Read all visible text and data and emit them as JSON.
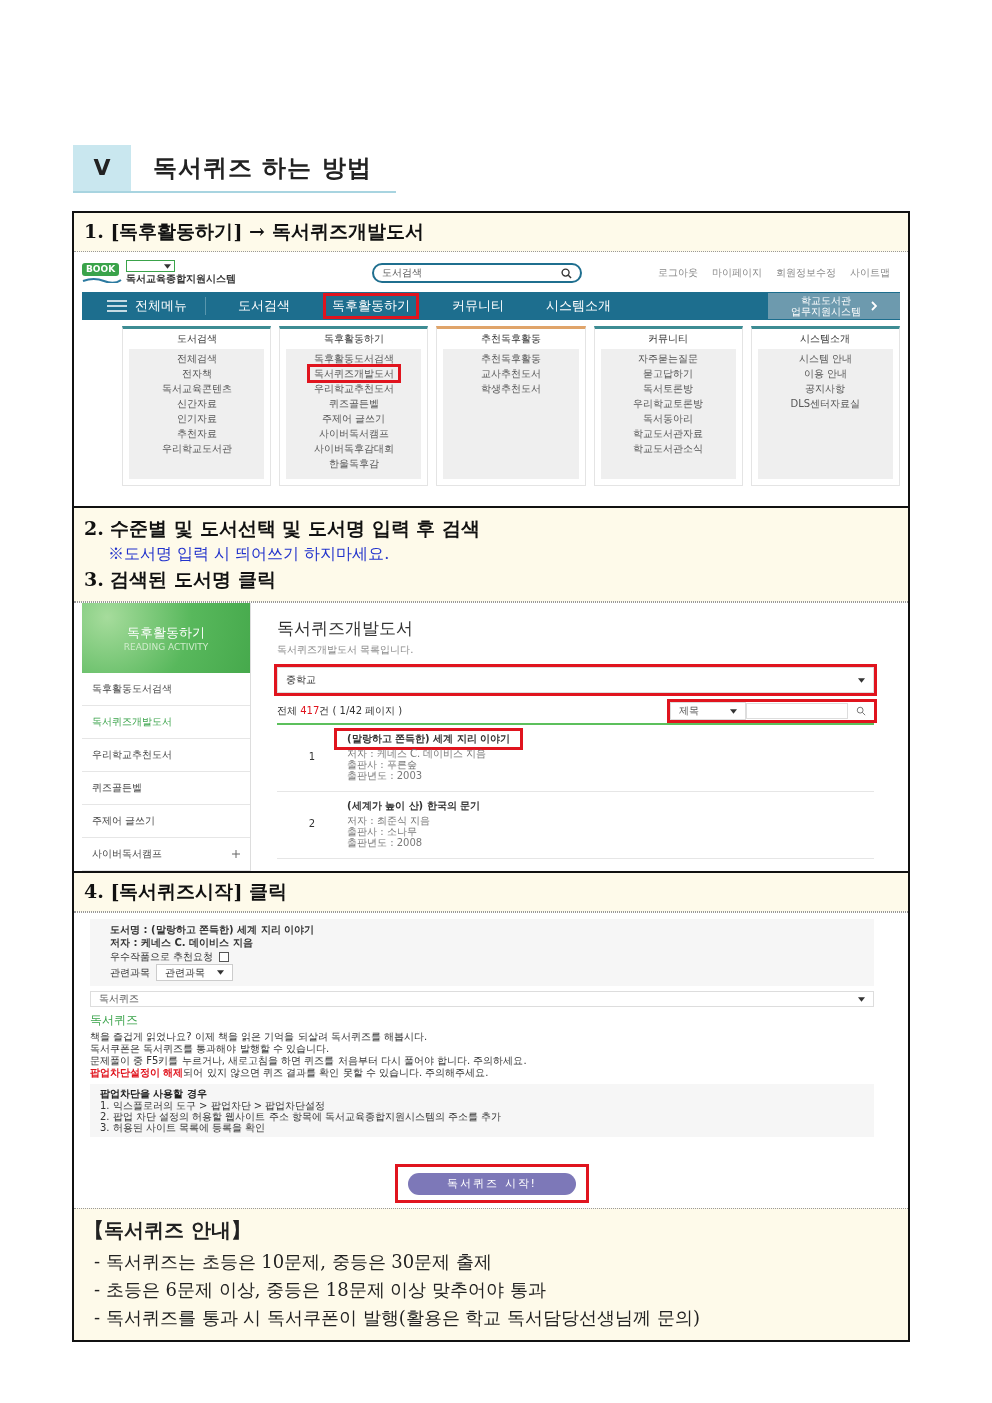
{
  "section": {
    "number": "V",
    "title": "독서퀴즈 하는 방법"
  },
  "step1": {
    "heading": "1. [독후활동하기] → 독서퀴즈개발도서"
  },
  "site": {
    "logo_badge": "BOOK",
    "logo_text": "독서교육종합지원시스템",
    "search_placeholder": "도서검색",
    "top_links": [
      "로그아웃",
      "마이페이지",
      "회원정보수정",
      "사이트맵"
    ],
    "menu_button": "전체메뉴",
    "nav": [
      {
        "label": "도서검색",
        "highlighted": false
      },
      {
        "label": "독후활동하기",
        "highlighted": true
      },
      {
        "label": "커뮤니티",
        "highlighted": false
      },
      {
        "label": "시스템소개",
        "highlighted": false
      }
    ],
    "side_button": "학교도서관\n업무지원시스템",
    "menu_columns": [
      {
        "title": "도서검색",
        "color": "#3d8c93",
        "items": [
          {
            "label": "전체검색",
            "highlighted": false
          },
          {
            "label": "전자책",
            "highlighted": false
          },
          {
            "label": "독서교육콘텐츠",
            "highlighted": false
          },
          {
            "label": "신간자료",
            "highlighted": false
          },
          {
            "label": "인기자료",
            "highlighted": false
          },
          {
            "label": "추천자료",
            "highlighted": false
          },
          {
            "label": "우리학교도서관",
            "highlighted": false
          }
        ]
      },
      {
        "title": "독후활동하기",
        "color": "#3d8c93",
        "items": [
          {
            "label": "독후활동도서검색",
            "highlighted": false
          },
          {
            "label": "독서퀴즈개발도서",
            "highlighted": true
          },
          {
            "label": "우리학교추천도서",
            "highlighted": false
          },
          {
            "label": "퀴즈골든벨",
            "highlighted": false
          },
          {
            "label": "주제어 글쓰기",
            "highlighted": false
          },
          {
            "label": "사이버독서캠프",
            "highlighted": false
          },
          {
            "label": "사이버독후감대회",
            "highlighted": false
          },
          {
            "label": "한울독후감",
            "highlighted": false
          }
        ]
      },
      {
        "title": "추천독후활동",
        "color": "#e0a46a",
        "items": [
          {
            "label": "추천독후활동",
            "highlighted": false
          },
          {
            "label": "교사추천도서",
            "highlighted": false
          },
          {
            "label": "학생추천도서",
            "highlighted": false
          }
        ]
      },
      {
        "title": "커뮤니티",
        "color": "#3d8c93",
        "items": [
          {
            "label": "자주묻는질문",
            "highlighted": false
          },
          {
            "label": "묻고답하기",
            "highlighted": false
          },
          {
            "label": "독서토론방",
            "highlighted": false
          },
          {
            "label": "우리학교토론방",
            "highlighted": false
          },
          {
            "label": "독서동아리",
            "highlighted": false
          },
          {
            "label": "학교도서관자료",
            "highlighted": false
          },
          {
            "label": "학교도서관소식",
            "highlighted": false
          }
        ]
      },
      {
        "title": "시스템소개",
        "color": "#3d8c93",
        "items": [
          {
            "label": "시스템 안내",
            "highlighted": false
          },
          {
            "label": "이용 안내",
            "highlighted": false
          },
          {
            "label": "공지사항",
            "highlighted": false
          },
          {
            "label": "DLS센터자료실",
            "highlighted": false
          }
        ]
      }
    ]
  },
  "step2": {
    "lines": [
      {
        "kind": "heading",
        "text": "2. 수준별 및 도서선택 및 도서명 입력 후 검색"
      },
      {
        "kind": "note",
        "text": "※도서명 입력 시 띄어쓰기 하지마세요."
      },
      {
        "kind": "heading",
        "text": "3. 검색된 도서명 클릭"
      }
    ]
  },
  "list_page": {
    "banner_title": "독후활동하기",
    "banner_subtitle": "READING ACTIVITY",
    "sidebar": [
      {
        "label": "독후활동도서검색",
        "selected": false,
        "expandable": false
      },
      {
        "label": "독서퀴즈개발도서",
        "selected": true,
        "expandable": false
      },
      {
        "label": "우리학교추천도서",
        "selected": false,
        "expandable": false
      },
      {
        "label": "퀴즈골든벨",
        "selected": false,
        "expandable": false
      },
      {
        "label": "주제어 글쓰기",
        "selected": false,
        "expandable": false
      },
      {
        "label": "사이버독서캠프",
        "selected": false,
        "expandable": true
      }
    ],
    "title": "독서퀴즈개발도서",
    "subtitle": "독서퀴즈개발도서 목록입니다.",
    "level_select": {
      "value": "중학교",
      "highlighted": true
    },
    "total_prefix": "전체",
    "total_count": "417",
    "total_suffix": "건 ( 1/42 페이지 )",
    "search": {
      "field": "제목",
      "highlighted": true
    },
    "results": [
      {
        "number": "1",
        "title": "(말랑하고 쫀득한) 세계 지리 이야기",
        "author": "저자 : 케네스 C. 데이비스 지음",
        "publisher": "출판사 : 푸른숲",
        "year": "출판년도 : 2003",
        "highlighted": true
      },
      {
        "number": "2",
        "title": "(세계가 높이 산) 한국의 문기",
        "author": "저자 : 최준식 지음",
        "publisher": "출판사 : 소나무",
        "year": "출판년도 : 2008",
        "highlighted": false
      }
    ]
  },
  "step4": {
    "heading": "4. [독서퀴즈시작] 클릭"
  },
  "quiz_page": {
    "info": [
      {
        "kind": "text",
        "text": "도서명 : (말랑하고 쫀득한) 세계 지리 이야기"
      },
      {
        "kind": "text",
        "text": "저자 : 케네스 C. 데이비스 지음"
      },
      {
        "kind": "checkbox",
        "text": "우수작품으로 추천요청",
        "checked": false
      },
      {
        "kind": "select",
        "text": "관련과목",
        "value": "관련과목"
      }
    ],
    "quiz_select": "독서퀴즈",
    "heading": "독서퀴즈",
    "lines": [
      {
        "text": "책을 즐겁게 읽었나요? 이제 책을 읽은 기억을 되살려 독서퀴즈를 해봅시다."
      },
      {
        "text": "독서쿠폰은 독서퀴즈를 통과해야 발행할 수 있습니다."
      },
      {
        "text": "문제풀이 중 F5키를 누르거나, 새로고침을 하면 퀴즈를 처음부터 다시 풀어야 합니다. 주의하세요."
      },
      {
        "alert": "팝업차단설정이 해제",
        "text": "되어 있지 않으면 퀴즈 결과를 확인 못할 수 있습니다. 주의해주세요."
      }
    ],
    "popup_title": "팝업차단을 사용할 경우",
    "popup_steps": [
      "1. 익스플로러의 도구 > 팝업차단 > 팝업차단설정",
      "2. 팝업 차단 설정의 허용할 웹사이트 주소 항목에 독서교육종합지원시스템의 주소를 추가",
      "3. 허용된 사이트 목록에 등록을 확인"
    ],
    "start_button": {
      "label": "독서퀴즈 시작!",
      "highlighted": true
    }
  },
  "guide": {
    "title": "【독서퀴즈 안내】",
    "items": [
      "- 독서퀴즈는 초등은 10문제, 중등은 30문제 출제",
      "- 초등은 6문제 이상, 중등은 18문제 이상 맞추어야 통과",
      "- 독서퀴즈를 통과 시 독서쿠폰이 발행(활용은 학교 독서담당선생님께 문의)"
    ]
  }
}
